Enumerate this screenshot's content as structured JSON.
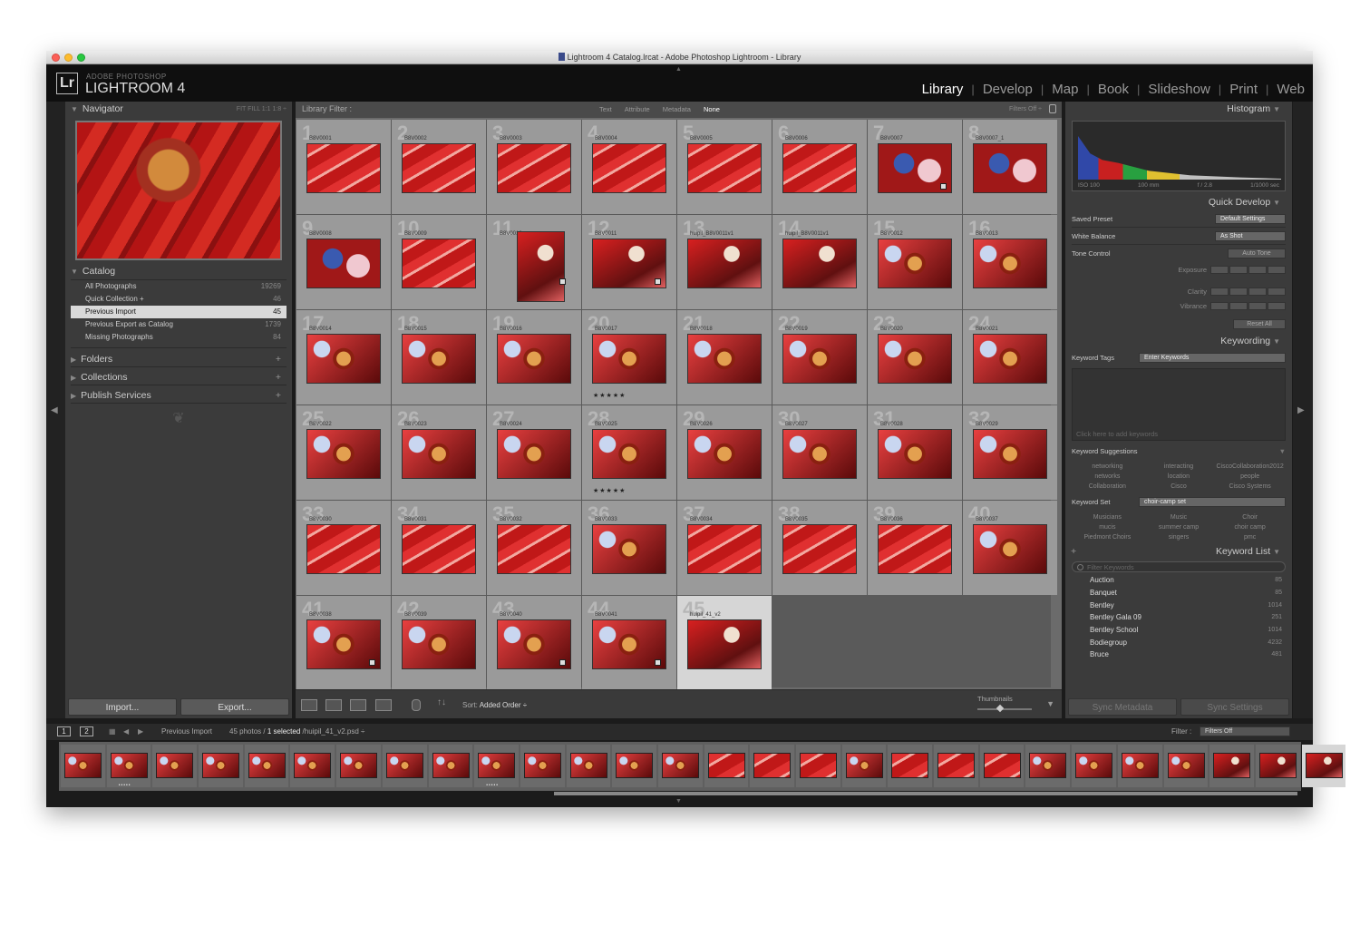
{
  "window": {
    "title": "Lightroom 4 Catalog.lrcat - Adobe Photoshop Lightroom - Library"
  },
  "brand": {
    "logo": "Lr",
    "line1": "ADOBE PHOTOSHOP",
    "line2": "LIGHTROOM 4"
  },
  "modules": [
    "Library",
    "Develop",
    "Map",
    "Book",
    "Slideshow",
    "Print",
    "Web"
  ],
  "active_module": "Library",
  "navigator": {
    "title": "Navigator",
    "zoom": "FIT  FILL  1:1  1:8 ÷"
  },
  "catalog": {
    "title": "Catalog",
    "items": [
      {
        "label": "All Photographs",
        "count": "19269"
      },
      {
        "label": "Quick Collection +",
        "count": "46"
      },
      {
        "label": "Previous Import",
        "count": "45"
      },
      {
        "label": "Previous Export as Catalog",
        "count": "1739"
      },
      {
        "label": "Missing Photographs",
        "count": "84"
      }
    ]
  },
  "sections": [
    "Folders",
    "Collections",
    "Publish Services"
  ],
  "left_buttons": {
    "import": "Import...",
    "export": "Export..."
  },
  "filter_bar": {
    "label": "Library Filter :",
    "options": [
      "Text",
      "Attribute",
      "Metadata",
      "None"
    ],
    "active": "None",
    "filters_off": "Filters Off ÷"
  },
  "grid": {
    "cells": [
      {
        "num": "1",
        "file": "B8V0001",
        "style": "t1"
      },
      {
        "num": "2",
        "file": "B8V0002",
        "style": "t1"
      },
      {
        "num": "3",
        "file": "B8V0003",
        "style": "t1"
      },
      {
        "num": "4",
        "file": "B8V0004",
        "style": "t1"
      },
      {
        "num": "5",
        "file": "B8V0005",
        "style": "t1"
      },
      {
        "num": "6",
        "file": "B8V0006",
        "style": "t1"
      },
      {
        "num": "7",
        "file": "B8V0007",
        "style": "t3",
        "badge": true
      },
      {
        "num": "8",
        "file": "B8V0007_1",
        "style": "t3"
      },
      {
        "num": "9",
        "file": "B8V0008",
        "style": "t3"
      },
      {
        "num": "10",
        "file": "B8V0009",
        "style": "t1"
      },
      {
        "num": "11",
        "file": "B8V0010",
        "style": "t4",
        "portrait": true,
        "badge": true
      },
      {
        "num": "12",
        "file": "B8V0011",
        "style": "t4",
        "badge": true
      },
      {
        "num": "13",
        "file": "huipil_B8V0011v1",
        "style": "t4"
      },
      {
        "num": "14",
        "file": "huipil_B8V0011v1",
        "style": "t4"
      },
      {
        "num": "15",
        "file": "B8V0012",
        "style": "t2"
      },
      {
        "num": "16",
        "file": "B8V0013",
        "style": "t2"
      },
      {
        "num": "17",
        "file": "B8V0014",
        "style": "t2"
      },
      {
        "num": "18",
        "file": "B8V0015",
        "style": "t2"
      },
      {
        "num": "19",
        "file": "B8V0016",
        "style": "t2"
      },
      {
        "num": "20",
        "file": "B8V0017",
        "style": "t2",
        "stars": "★★★★★"
      },
      {
        "num": "21",
        "file": "B8V0018",
        "style": "t2"
      },
      {
        "num": "22",
        "file": "B8V0019",
        "style": "t2"
      },
      {
        "num": "23",
        "file": "B8V0020",
        "style": "t2"
      },
      {
        "num": "24",
        "file": "B8V0021",
        "style": "t2"
      },
      {
        "num": "25",
        "file": "B8V0022",
        "style": "t2"
      },
      {
        "num": "26",
        "file": "B8V0023",
        "style": "t2"
      },
      {
        "num": "27",
        "file": "B8V0024",
        "style": "t2"
      },
      {
        "num": "28",
        "file": "B8V0025",
        "style": "t2",
        "stars": "★★★★★"
      },
      {
        "num": "29",
        "file": "B8V0026",
        "style": "t2"
      },
      {
        "num": "30",
        "file": "B8V0027",
        "style": "t2"
      },
      {
        "num": "31",
        "file": "B8V0028",
        "style": "t2"
      },
      {
        "num": "32",
        "file": "B8V0029",
        "style": "t2"
      },
      {
        "num": "33",
        "file": "B8V0030",
        "style": "t1"
      },
      {
        "num": "34",
        "file": "B8V0031",
        "style": "t1"
      },
      {
        "num": "35",
        "file": "B8V0032",
        "style": "t1"
      },
      {
        "num": "36",
        "file": "B8V0033",
        "style": "t2"
      },
      {
        "num": "37",
        "file": "B8V0034",
        "style": "t1"
      },
      {
        "num": "38",
        "file": "B8V0035",
        "style": "t1"
      },
      {
        "num": "39",
        "file": "B8V0036",
        "style": "t1"
      },
      {
        "num": "40",
        "file": "B8V0037",
        "style": "t2"
      },
      {
        "num": "41",
        "file": "B8V0038",
        "style": "t2",
        "badge": true
      },
      {
        "num": "42",
        "file": "B8V0039",
        "style": "t2"
      },
      {
        "num": "43",
        "file": "B8V0040",
        "style": "t2",
        "badge": true
      },
      {
        "num": "44",
        "file": "B8V0041",
        "style": "t2",
        "badge": true
      },
      {
        "num": "45",
        "file": "huipil_41_v2",
        "style": "t4",
        "selected": true
      }
    ]
  },
  "toolbar": {
    "sort_label": "Sort:",
    "sort_value": "Added Order ÷",
    "thumbnails": "Thumbnails"
  },
  "histogram": {
    "title": "Histogram",
    "iso": "ISO 100",
    "focal": "100 mm",
    "aperture": "f / 2.8",
    "shutter": "1/1000 sec"
  },
  "quick_develop": {
    "title": "Quick Develop",
    "saved_preset": {
      "label": "Saved Preset",
      "value": "Default Settings"
    },
    "white_balance": {
      "label": "White Balance",
      "value": "As Shot"
    },
    "tone_control": {
      "label": "Tone Control",
      "button": "Auto Tone"
    },
    "rows": [
      "Exposure",
      "Clarity",
      "Vibrance"
    ],
    "reset": "Reset All"
  },
  "keywording": {
    "title": "Keywording",
    "tags_label": "Keyword Tags",
    "tags_value": "Enter Keywords",
    "placeholder": "Click here to add keywords",
    "suggestions_title": "Keyword Suggestions",
    "suggestions": [
      "networking",
      "interacting",
      "CiscoCollaboration2012",
      "networks",
      "location",
      "people",
      "Collaboration",
      "Cisco",
      "Cisco Systems"
    ],
    "set_label": "Keyword Set",
    "set_value": "choir-camp set",
    "set_items": [
      "Musicians",
      "Music",
      "Choir",
      "mucis",
      "summer camp",
      "choir camp",
      "Piedmont Choirs",
      "singers",
      "pmc"
    ]
  },
  "keyword_list": {
    "title": "Keyword List",
    "filter_placeholder": "Filter Keywords",
    "items": [
      {
        "label": "Auction",
        "count": "85"
      },
      {
        "label": "Banquet",
        "count": "85"
      },
      {
        "label": "Bentley",
        "count": "1014"
      },
      {
        "label": "Bentley Gala 09",
        "count": "251"
      },
      {
        "label": "Bentley School",
        "count": "1014"
      },
      {
        "label": "Bodiegroup",
        "count": "4232"
      },
      {
        "label": "Bruce",
        "count": "481"
      }
    ]
  },
  "right_buttons": {
    "sync_metadata": "Sync Metadata",
    "sync_settings": "Sync Settings"
  },
  "filmstrip": {
    "screen1": "1",
    "screen2": "2",
    "source": "Previous Import",
    "count": "45 photos /",
    "selected": "1 selected",
    "file": "/huipil_41_v2.psd ÷",
    "filter_label": "Filter :",
    "filter_value": "Filters Off",
    "thumbs": [
      {
        "style": "t2"
      },
      {
        "style": "t2",
        "stars": "•••••"
      },
      {
        "style": "t2"
      },
      {
        "style": "t2"
      },
      {
        "style": "t2"
      },
      {
        "style": "t2"
      },
      {
        "style": "t2"
      },
      {
        "style": "t2"
      },
      {
        "style": "t2"
      },
      {
        "style": "t2",
        "stars": "•••••"
      },
      {
        "style": "t2"
      },
      {
        "style": "t2"
      },
      {
        "style": "t2"
      },
      {
        "style": "t2"
      },
      {
        "style": "t1"
      },
      {
        "style": "t1"
      },
      {
        "style": "t1"
      },
      {
        "style": "t2"
      },
      {
        "style": "t1"
      },
      {
        "style": "t1"
      },
      {
        "style": "t1"
      },
      {
        "style": "t2"
      },
      {
        "style": "t2"
      },
      {
        "style": "t2"
      },
      {
        "style": "t2"
      },
      {
        "style": "t4"
      },
      {
        "style": "t4"
      },
      {
        "style": "t4",
        "selected": true
      }
    ]
  }
}
